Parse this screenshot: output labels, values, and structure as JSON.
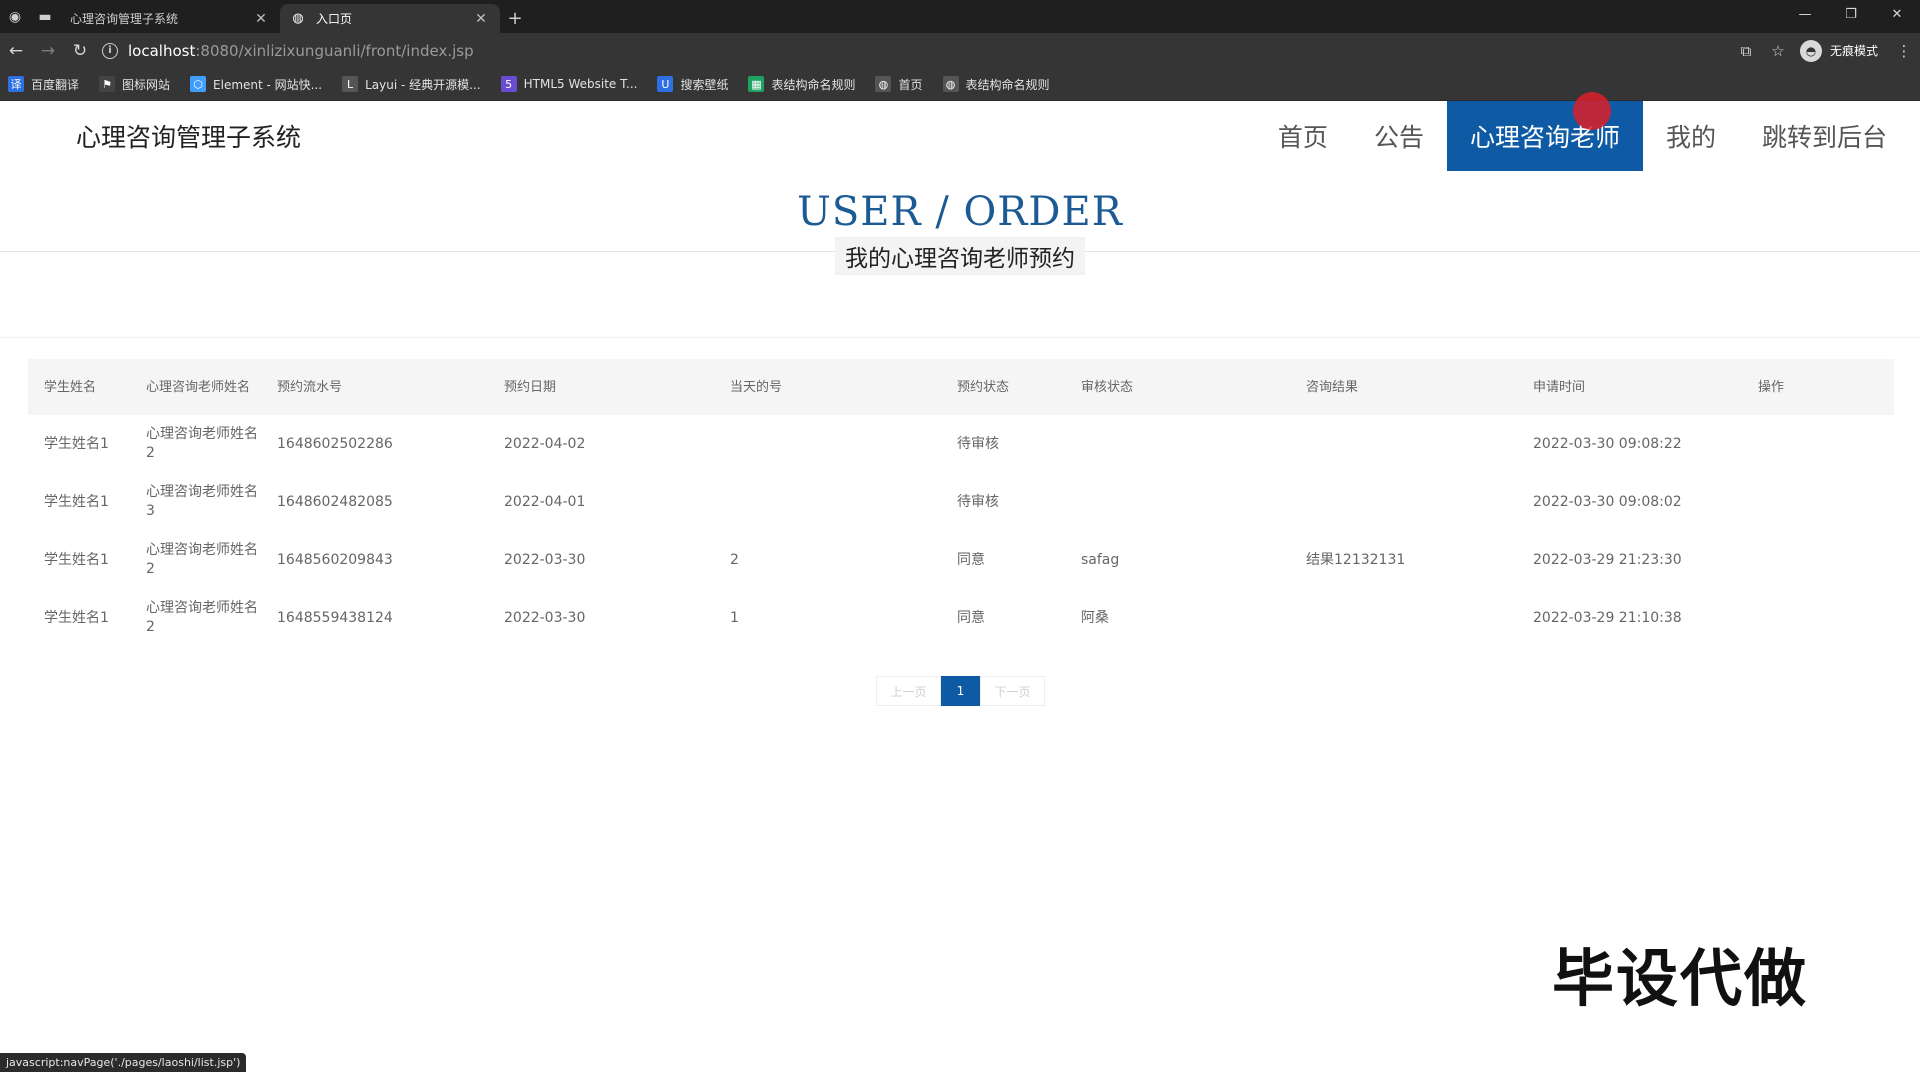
{
  "browser": {
    "tabs": [
      {
        "title": "心理咨询管理子系统",
        "active": false
      },
      {
        "title": "入口页",
        "active": true
      }
    ],
    "url": {
      "host": "localhost",
      "path": ":8080/xinlizixunguanli/front/index.jsp"
    },
    "incognito_label": "无痕模式",
    "bookmarks": [
      {
        "label": "百度翻译",
        "icon": "translate-icon",
        "color": "#2f6fe4"
      },
      {
        "label": "图标网站",
        "icon": "flag-icon",
        "color": "#444444"
      },
      {
        "label": "Element - 网站快...",
        "icon": "element-icon",
        "color": "#409eff"
      },
      {
        "label": "Layui - 经典开源模...",
        "icon": "layui-icon",
        "color": "#555555"
      },
      {
        "label": "HTML5 Website T...",
        "icon": "html5-icon",
        "color": "#6a4cd1"
      },
      {
        "label": "搜索壁纸",
        "icon": "wallpaper-icon",
        "color": "#2f6fe4"
      },
      {
        "label": "表结构命名规则",
        "icon": "sheet-icon",
        "color": "#1ea362"
      },
      {
        "label": "首页",
        "icon": "globe-icon",
        "color": "#555555"
      },
      {
        "label": "表结构命名规则",
        "icon": "globe-icon",
        "color": "#555555"
      }
    ],
    "status_text": "javascript:navPage('./pages/laoshi/list.jsp')"
  },
  "site": {
    "title": "心理咨询管理子系统",
    "nav": [
      {
        "label": "首页",
        "active": false
      },
      {
        "label": "公告",
        "active": false
      },
      {
        "label": "心理咨询老师",
        "active": true
      },
      {
        "label": "我的",
        "active": false
      },
      {
        "label": "跳转到后台",
        "active": false
      }
    ],
    "accent_color": "#0f5aa5"
  },
  "section": {
    "title_en": "USER / ORDER",
    "title_cn": "我的心理咨询老师预约"
  },
  "table": {
    "columns": [
      "学生姓名",
      "心理咨询老师姓名",
      "预约流水号",
      "预约日期",
      "当天的号",
      "预约状态",
      "审核状态",
      "咨询结果",
      "申请时间",
      "操作"
    ],
    "rows": [
      [
        "学生姓名1",
        "心理咨询老师姓名2",
        "1648602502286",
        "2022-04-02",
        "",
        "待审核",
        "",
        "",
        "2022-03-30 09:08:22",
        ""
      ],
      [
        "学生姓名1",
        "心理咨询老师姓名3",
        "1648602482085",
        "2022-04-01",
        "",
        "待审核",
        "",
        "",
        "2022-03-30 09:08:02",
        ""
      ],
      [
        "学生姓名1",
        "心理咨询老师姓名2",
        "1648560209843",
        "2022-03-30",
        "2",
        "同意",
        "safag",
        "结果12132131",
        "2022-03-29 21:23:30",
        ""
      ],
      [
        "学生姓名1",
        "心理咨询老师姓名2",
        "1648559438124",
        "2022-03-30",
        "1",
        "同意",
        "阿桑",
        "",
        "2022-03-29 21:10:38",
        ""
      ]
    ]
  },
  "pagination": {
    "prev_label": "上一页",
    "current": "1",
    "next_label": "下一页"
  },
  "watermark": "毕设代做"
}
